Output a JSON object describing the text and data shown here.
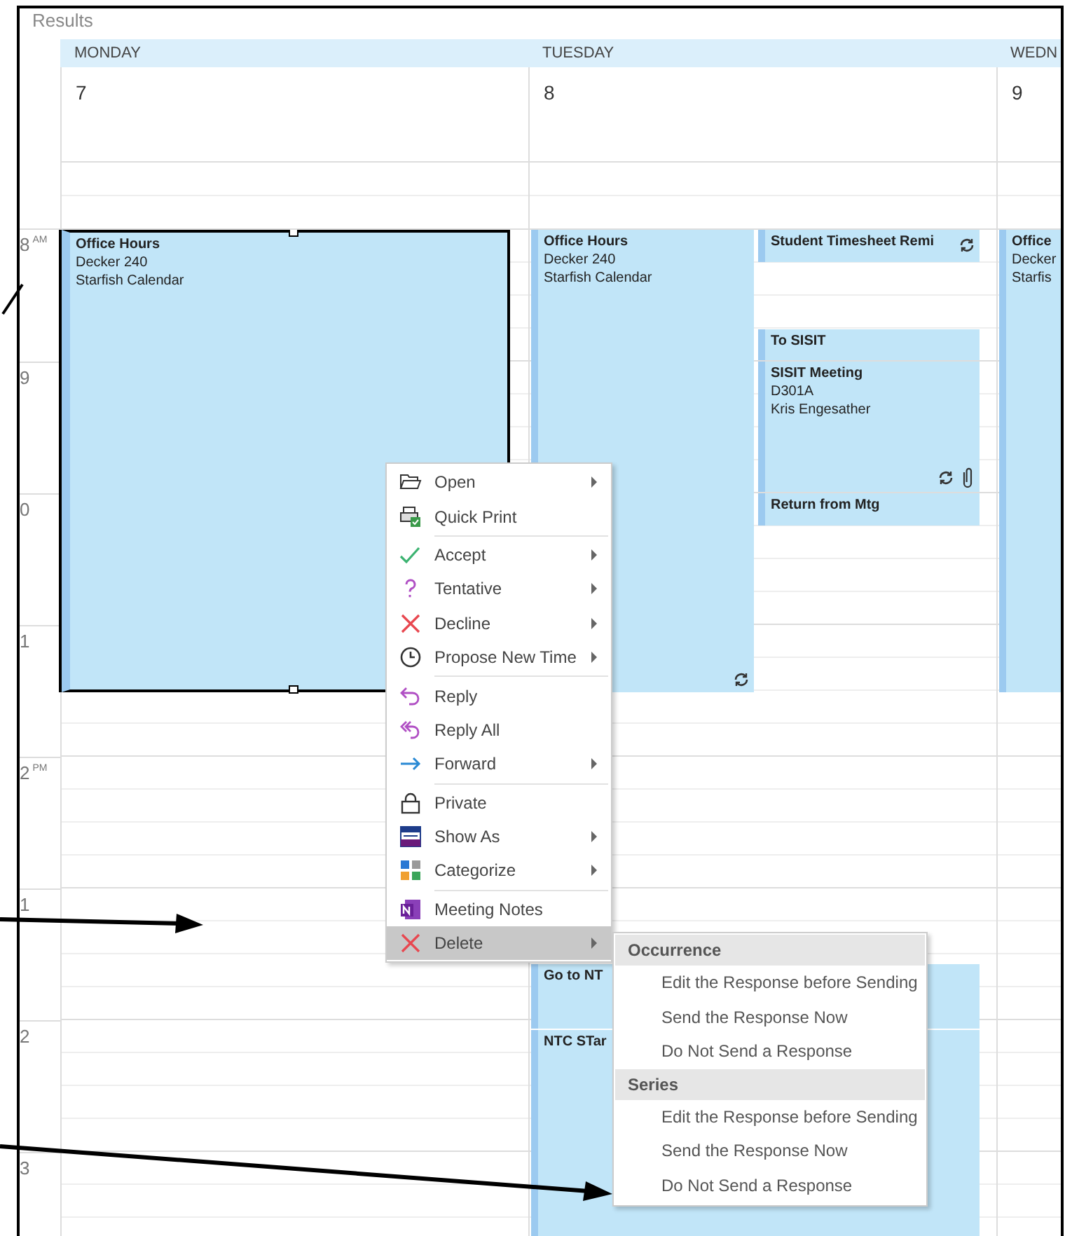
{
  "title": "Results",
  "days": [
    {
      "name": "MONDAY",
      "date": "7",
      "events": [
        {
          "title": "Office Hours",
          "lines": [
            "Decker 240",
            "Starfish Calendar"
          ],
          "selected": true,
          "recurring": false,
          "attachment": false
        }
      ]
    },
    {
      "name": "TUESDAY",
      "date": "8",
      "events": [
        {
          "title": "Office Hours",
          "lines": [
            "Decker 240",
            "Starfish Calendar"
          ],
          "selected": false,
          "recurring": true,
          "attachment": false
        },
        {
          "title": "Student Timesheet Remi",
          "selected": false,
          "recurring": true,
          "attachment": false
        },
        {
          "title": "To SISIT",
          "selected": false,
          "recurring": false,
          "attachment": false
        },
        {
          "title": "SISIT Meeting",
          "lines": [
            "D301A",
            "Kris Engesather"
          ],
          "selected": false,
          "recurring": true,
          "attachment": true
        },
        {
          "title": "Return from Mtg",
          "selected": false,
          "recurring": false,
          "attachment": false
        },
        {
          "title": "Go to NT",
          "selected": false,
          "recurring": false,
          "attachment": false
        },
        {
          "title": "NTC STar",
          "selected": false,
          "recurring": false,
          "attachment": false
        }
      ]
    },
    {
      "name": "WEDN",
      "date": "9",
      "events": [
        {
          "title": "Office",
          "lines": [
            "Decker",
            "Starfis"
          ],
          "selected": false,
          "recurring": false,
          "attachment": false
        }
      ]
    }
  ],
  "hours": [
    {
      "hour": "8",
      "suffix": "AM"
    },
    {
      "hour": "9"
    },
    {
      "hour": "0"
    },
    {
      "hour": "1"
    },
    {
      "hour": "2",
      "suffix": "PM"
    },
    {
      "hour": "1"
    },
    {
      "hour": "2"
    },
    {
      "hour": "3"
    }
  ],
  "context_menu": {
    "groups": [
      [
        {
          "label": "Open",
          "submenu": true,
          "selected": false
        },
        {
          "label": "Quick Print",
          "submenu": false,
          "selected": false
        }
      ],
      [
        {
          "label": "Accept",
          "submenu": true,
          "selected": false
        },
        {
          "label": "Tentative",
          "submenu": true,
          "selected": false
        },
        {
          "label": "Decline",
          "submenu": true,
          "selected": false
        },
        {
          "label": "Propose New Time",
          "submenu": true,
          "selected": false
        }
      ],
      [
        {
          "label": "Reply",
          "submenu": false,
          "selected": false
        },
        {
          "label": "Reply All",
          "submenu": false,
          "selected": false
        },
        {
          "label": "Forward",
          "submenu": true,
          "selected": false
        }
      ],
      [
        {
          "label": "Private",
          "submenu": false,
          "selected": false
        },
        {
          "label": "Show As",
          "submenu": true,
          "selected": false
        },
        {
          "label": "Categorize",
          "submenu": true,
          "selected": false
        }
      ],
      [
        {
          "label": "Meeting Notes",
          "submenu": false,
          "selected": false
        },
        {
          "label": "Delete",
          "submenu": true,
          "selected": true
        }
      ]
    ]
  },
  "submenu": [
    {
      "kind": "header",
      "label": "Occurrence"
    },
    {
      "kind": "item",
      "label": "Edit the Response before Sending"
    },
    {
      "kind": "item",
      "label": "Send the Response Now"
    },
    {
      "kind": "item",
      "label": "Do Not Send a Response"
    },
    {
      "kind": "header",
      "label": "Series"
    },
    {
      "kind": "item",
      "label": "Edit the Response before Sending"
    },
    {
      "kind": "item",
      "label": "Send the Response Now"
    },
    {
      "kind": "item",
      "label": "Do Not Send a Response"
    }
  ]
}
